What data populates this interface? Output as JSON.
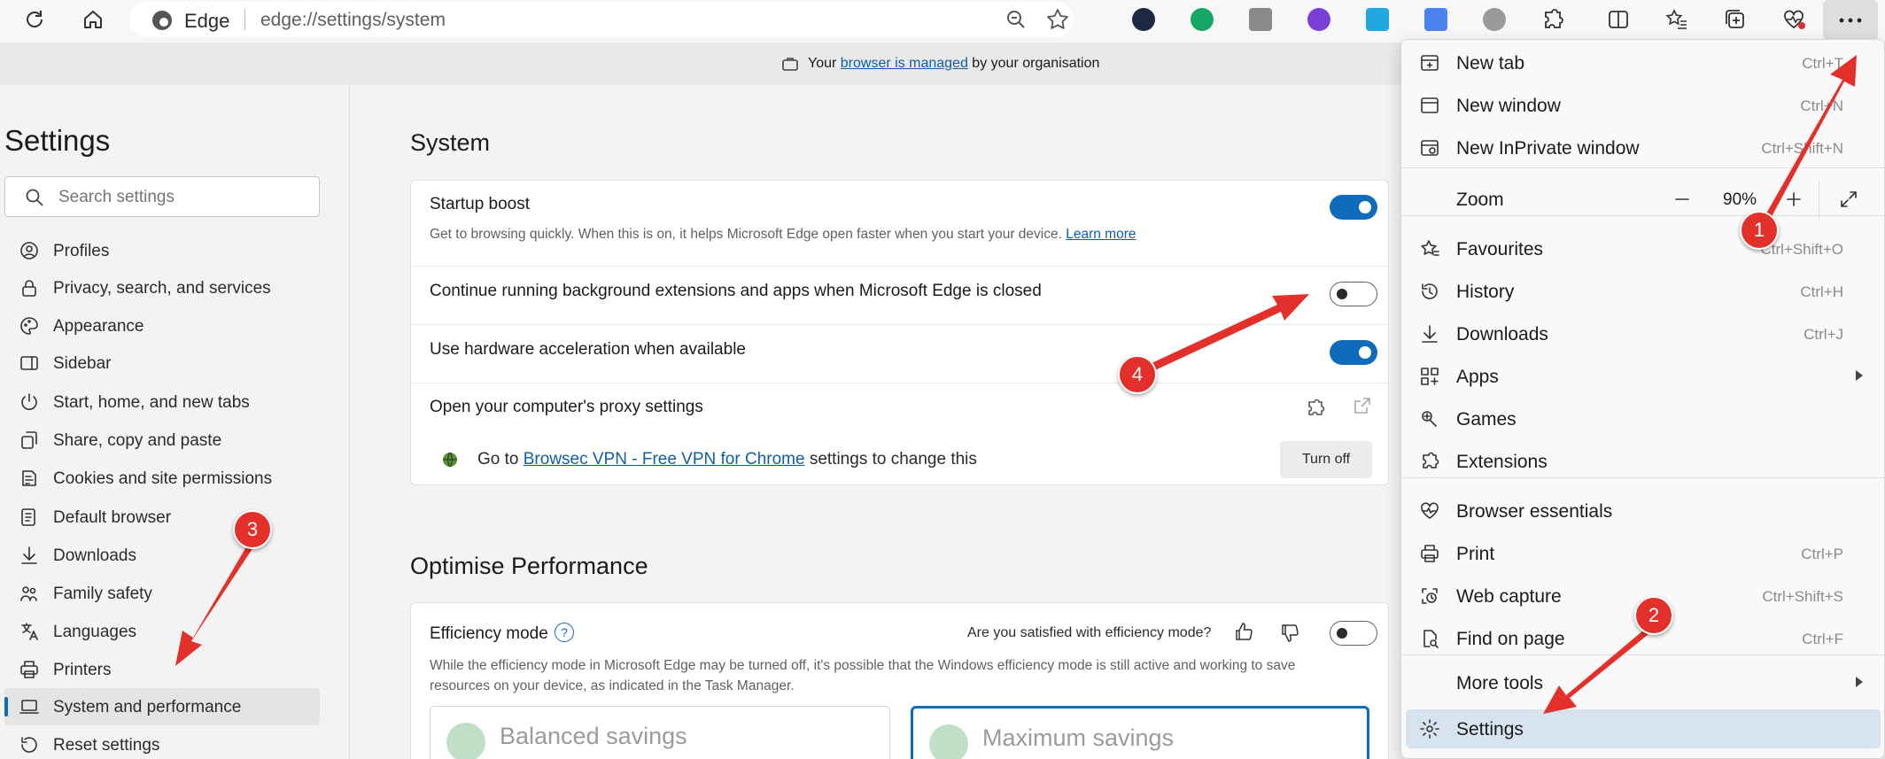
{
  "toolbar": {
    "site_name": "Edge",
    "url": "edge://settings/system"
  },
  "managed_bar": {
    "prefix": "Your ",
    "link": "browser is managed",
    "suffix": " by your organisation"
  },
  "sidebar": {
    "title": "Settings",
    "search_placeholder": "Search settings",
    "items": [
      {
        "label": "Profiles",
        "icon": "profile-icon"
      },
      {
        "label": "Privacy, search, and services",
        "icon": "lock-icon"
      },
      {
        "label": "Appearance",
        "icon": "appearance-icon"
      },
      {
        "label": "Sidebar",
        "icon": "sidebar-icon"
      },
      {
        "label": "Start, home, and new tabs",
        "icon": "power-icon"
      },
      {
        "label": "Share, copy and paste",
        "icon": "share-icon"
      },
      {
        "label": "Cookies and site permissions",
        "icon": "cookies-icon"
      },
      {
        "label": "Default browser",
        "icon": "browser-icon"
      },
      {
        "label": "Downloads",
        "icon": "download-icon"
      },
      {
        "label": "Family safety",
        "icon": "family-icon"
      },
      {
        "label": "Languages",
        "icon": "language-icon"
      },
      {
        "label": "Printers",
        "icon": "printer-icon"
      },
      {
        "label": "System and performance",
        "icon": "laptop-icon",
        "active": true
      },
      {
        "label": "Reset settings",
        "icon": "reset-icon"
      }
    ]
  },
  "system": {
    "heading": "System",
    "startup_boost": {
      "title": "Startup boost",
      "desc": "Get to browsing quickly. When this is on, it helps Microsoft Edge open faster when you start your device.",
      "link": "Learn more",
      "enabled": true
    },
    "background_apps": {
      "title": "Continue running background extensions and apps when Microsoft Edge is closed",
      "enabled": false
    },
    "hardware_accel": {
      "title": "Use hardware acceleration when available",
      "enabled": true
    },
    "proxy": {
      "title": "Open your computer's proxy settings",
      "note_prefix": "Go to ",
      "note_link": "Browsec VPN - Free VPN for Chrome",
      "note_suffix": " settings to change this",
      "button": "Turn off"
    }
  },
  "performance": {
    "heading": "Optimise Performance",
    "efficiency": {
      "title": "Efficiency mode",
      "question": "Are you satisfied with efficiency mode?",
      "enabled": false,
      "desc_line1": "While the efficiency mode in Microsoft Edge may be turned off, it's possible that the Windows efficiency mode is still active and working to save",
      "desc_line2": "resources on your device, as indicated in the Task Manager.",
      "options": [
        "Balanced savings",
        "Maximum savings"
      ]
    }
  },
  "menu": {
    "items": [
      {
        "label": "New tab",
        "shortcut": "Ctrl+T",
        "icon": "new-tab-icon"
      },
      {
        "label": "New window",
        "shortcut": "Ctrl+N",
        "icon": "new-window-icon"
      },
      {
        "label": "New InPrivate window",
        "shortcut": "Ctrl+Shift+N",
        "icon": "inprivate-icon"
      },
      {
        "label": "Favourites",
        "shortcut": "Ctrl+Shift+O",
        "icon": "favourites-icon"
      },
      {
        "label": "History",
        "shortcut": "Ctrl+H",
        "icon": "history-icon"
      },
      {
        "label": "Downloads",
        "shortcut": "Ctrl+J",
        "icon": "download-icon"
      },
      {
        "label": "Apps",
        "shortcut": "",
        "icon": "apps-icon"
      },
      {
        "label": "Games",
        "shortcut": "",
        "icon": "games-icon"
      },
      {
        "label": "Extensions",
        "shortcut": "",
        "icon": "extensions-icon"
      },
      {
        "label": "Browser essentials",
        "shortcut": "",
        "icon": "heart-pulse-icon"
      },
      {
        "label": "Print",
        "shortcut": "Ctrl+P",
        "icon": "print-icon"
      },
      {
        "label": "Web capture",
        "shortcut": "Ctrl+Shift+S",
        "icon": "web-capture-icon"
      },
      {
        "label": "Find on page",
        "shortcut": "Ctrl+F",
        "icon": "find-icon"
      },
      {
        "label": "More tools",
        "shortcut": "",
        "icon": ""
      },
      {
        "label": "Settings",
        "shortcut": "",
        "icon": "gear-icon"
      }
    ],
    "zoom_label": "Zoom",
    "zoom_value": "90%"
  },
  "markers": [
    "1",
    "2",
    "3",
    "4"
  ],
  "colors": {
    "accent": "#0f6cbd",
    "marker": "#e4302a"
  }
}
